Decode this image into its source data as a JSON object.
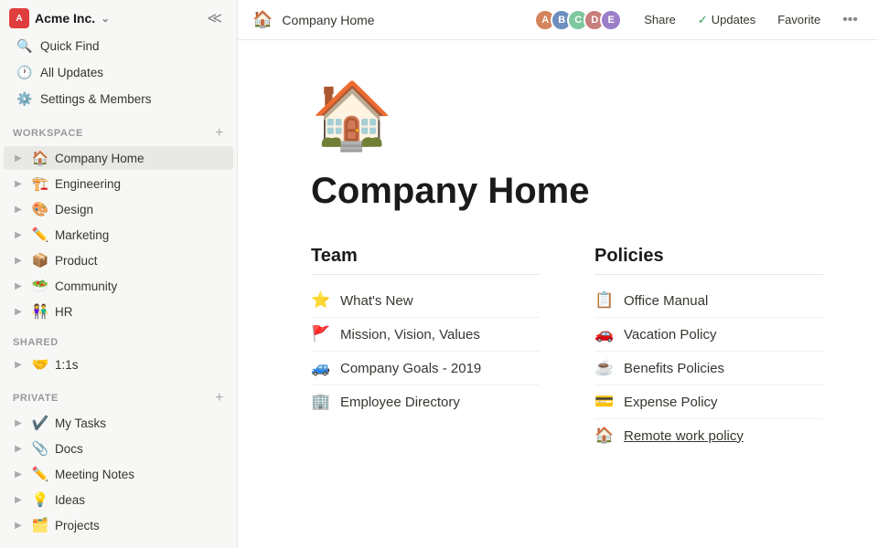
{
  "workspace": {
    "name": "Acme Inc.",
    "logo_text": "A"
  },
  "sidebar": {
    "quick_find": "Quick Find",
    "all_updates": "All Updates",
    "settings": "Settings & Members",
    "workspace_label": "WORKSPACE",
    "shared_label": "SHARED",
    "private_label": "PRIVATE",
    "workspace_items": [
      {
        "id": "company-home",
        "emoji": "🏠",
        "label": "Company Home",
        "active": true
      },
      {
        "id": "engineering",
        "emoji": "🏗️",
        "label": "Engineering",
        "active": false
      },
      {
        "id": "design",
        "emoji": "🎨",
        "label": "Design",
        "active": false
      },
      {
        "id": "marketing",
        "emoji": "✏️",
        "label": "Marketing",
        "active": false
      },
      {
        "id": "product",
        "emoji": "📦",
        "label": "Product",
        "active": false
      },
      {
        "id": "community",
        "emoji": "🥗",
        "label": "Community",
        "active": false
      },
      {
        "id": "hr",
        "emoji": "👫",
        "label": "HR",
        "active": false
      }
    ],
    "shared_items": [
      {
        "id": "1on1s",
        "emoji": "🤝",
        "label": "1:1s",
        "active": false
      }
    ],
    "private_items": [
      {
        "id": "my-tasks",
        "emoji": "✔️",
        "label": "My Tasks",
        "active": false
      },
      {
        "id": "docs",
        "emoji": "📎",
        "label": "Docs",
        "active": false
      },
      {
        "id": "meeting-notes",
        "emoji": "✏️",
        "label": "Meeting Notes",
        "active": false
      },
      {
        "id": "ideas",
        "emoji": "💡",
        "label": "Ideas",
        "active": false
      },
      {
        "id": "projects",
        "emoji": "🗂️",
        "label": "Projects",
        "active": false
      }
    ]
  },
  "header": {
    "page_icon": "🏠",
    "page_title": "Company Home",
    "share_label": "Share",
    "updates_label": "Updates",
    "favorite_label": "Favorite"
  },
  "page": {
    "house_icon": "🏠",
    "title": "Company Home",
    "team_section": {
      "heading": "Team",
      "items": [
        {
          "emoji": "⭐",
          "label": "What's New"
        },
        {
          "emoji": "🚩",
          "label": "Mission, Vision, Values"
        },
        {
          "emoji": "🚙",
          "label": "Company Goals - 2019"
        },
        {
          "emoji": "🏢",
          "label": "Employee Directory"
        }
      ]
    },
    "policies_section": {
      "heading": "Policies",
      "items": [
        {
          "emoji": "📋",
          "label": "Office Manual"
        },
        {
          "emoji": "🚗",
          "label": "Vacation Policy"
        },
        {
          "emoji": "☕",
          "label": "Benefits Policies"
        },
        {
          "emoji": "💳",
          "label": "Expense Policy"
        },
        {
          "emoji": "🏠",
          "label": "Remote work policy",
          "underline": true
        }
      ]
    }
  }
}
